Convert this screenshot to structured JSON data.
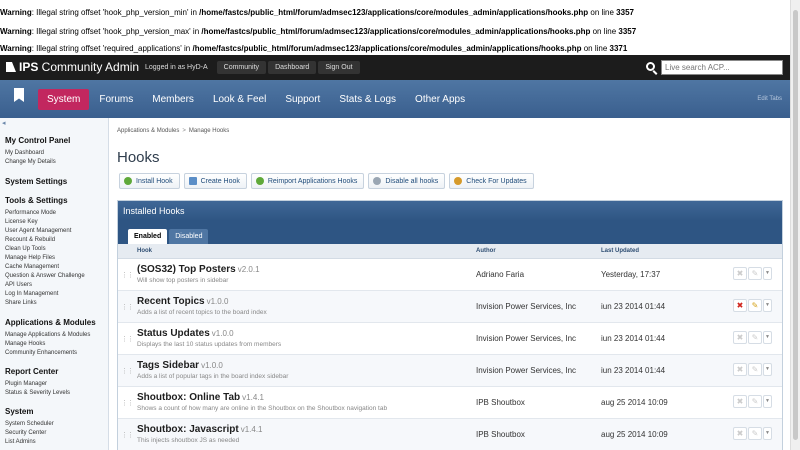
{
  "warnings": [
    {
      "label": "Warning",
      "text": ": Illegal string offset 'hook_php_version_min' in ",
      "path": "/home/fastcs/public_html/forum/admsec123/applications/core/modules_admin/applications/hooks.php",
      "line_text": " on line ",
      "line": "3357"
    },
    {
      "label": "Warning",
      "text": ": Illegal string offset 'hook_php_version_max' in ",
      "path": "/home/fastcs/public_html/forum/admsec123/applications/core/modules_admin/applications/hooks.php",
      "line_text": " on line ",
      "line": "3357"
    },
    {
      "label": "Warning",
      "text": ": Illegal string offset 'required_applications' in ",
      "path": "/home/fastcs/public_html/forum/admsec123/applications/core/modules_admin/applications/hooks.php",
      "line_text": " on line ",
      "line": "3371"
    }
  ],
  "topbar": {
    "brand_prefix": "IPS",
    "brand_suffix": " Community Admin",
    "logged_in": "Logged in as HyD-A",
    "links": [
      "Community",
      "Dashboard",
      "Sign Out"
    ],
    "search_placeholder": "Live search ACP..."
  },
  "nav": {
    "tabs": [
      "System",
      "Forums",
      "Members",
      "Look & Feel",
      "Support",
      "Stats & Logs",
      "Other Apps"
    ],
    "active": "System",
    "edit_tabs": "Edit Tabs"
  },
  "sidebar": {
    "sections": [
      {
        "title": "My Control Panel",
        "items": [
          "My Dashboard",
          "Change My Details"
        ]
      },
      {
        "title": "System Settings",
        "items": []
      },
      {
        "title": "Tools & Settings",
        "items": [
          "Performance Mode",
          "License Key",
          "User Agent Management",
          "Recount & Rebuild",
          "Clean Up Tools",
          "Manage Help Files",
          "Cache Management",
          "Question & Answer Challenge",
          "API Users",
          "Log In Management",
          "Share Links"
        ]
      },
      {
        "title": "Applications & Modules",
        "items": [
          "Manage Applications & Modules",
          "Manage Hooks",
          "Community Enhancements"
        ]
      },
      {
        "title": "Report Center",
        "items": [
          "Plugin Manager",
          "Status & Severity Levels"
        ]
      },
      {
        "title": "System",
        "items": [
          "System Scheduler",
          "Security Center",
          "List Admins"
        ]
      }
    ]
  },
  "breadcrumb": [
    "Applications & Modules",
    "Manage Hooks"
  ],
  "breadcrumb_sep": ">",
  "page_title": "Hooks",
  "actions": [
    "Install Hook",
    "Create Hook",
    "Reimport Applications Hooks",
    "Disable all hooks",
    "Check For Updates"
  ],
  "panel": {
    "title": "Installed Hooks",
    "tabs": [
      "Enabled",
      "Disabled"
    ],
    "columns": {
      "hook": "Hook",
      "author": "Author",
      "updated": "Last Updated"
    },
    "rows": [
      {
        "name": "(SOS32) Top Posters",
        "version": "v2.0.1",
        "desc": "Will show top posters in sidebar",
        "author": "Adriano Faria",
        "date": "Yesterday, 17:37",
        "live": false
      },
      {
        "name": "Recent Topics",
        "version": "v1.0.0",
        "desc": "Adds a list of recent topics to the board index",
        "author": "Invision Power Services, Inc",
        "date": "iun 23 2014 01:44",
        "live": true
      },
      {
        "name": "Status Updates",
        "version": "v1.0.0",
        "desc": "Displays the last 10 status updates from members",
        "author": "Invision Power Services, Inc",
        "date": "iun 23 2014 01:44",
        "live": false
      },
      {
        "name": "Tags Sidebar",
        "version": "v1.0.0",
        "desc": "Adds a list of popular tags in the board index sidebar",
        "author": "Invision Power Services, Inc",
        "date": "iun 23 2014 01:44",
        "live": false
      },
      {
        "name": "Shoutbox: Online Tab",
        "version": "v1.4.1",
        "desc": "Shows a count of how many are online in the Shoutbox on the Shoutbox navigation tab",
        "author": "IPB Shoutbox",
        "date": "aug 25 2014 10:09",
        "live": false
      },
      {
        "name": "Shoutbox: Javascript",
        "version": "v1.4.1",
        "desc": "This injects shoutbox JS as needed",
        "author": "IPB Shoutbox",
        "date": "aug 25 2014 10:09",
        "live": false
      }
    ]
  },
  "colors": {
    "accent": "#c2275f",
    "nav": "#3a5f8e",
    "topbar": "#1c1c1c"
  }
}
